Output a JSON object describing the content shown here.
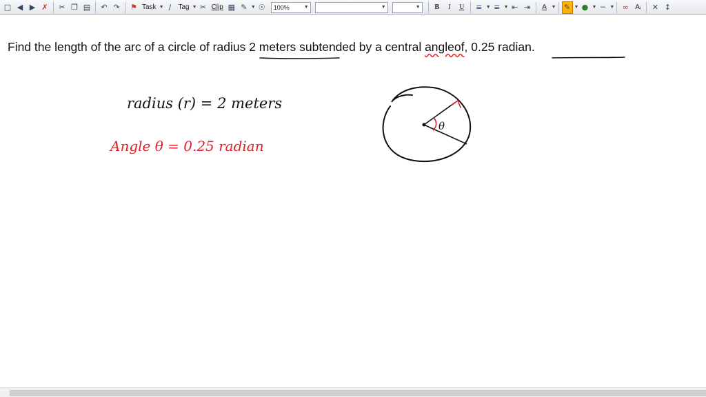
{
  "toolbar": {
    "task_label": "Task",
    "tag_label": "Tag",
    "clip_label": "Clip",
    "zoom_value": "100%",
    "font_name_value": "",
    "font_size_value": "",
    "bold_label": "B",
    "italic_label": "I",
    "underline_label": "U",
    "font_color_label": "A",
    "clear_format_label": "Aᵢ",
    "colors": {
      "highlight": "#ff9900",
      "font": "#c00000",
      "ink": "#2e7d32"
    },
    "icons": [
      "new-page-icon",
      "back-arrow-icon",
      "forward-arrow-icon",
      "delete-page-icon",
      "cut-icon",
      "copy-icon",
      "paste-icon",
      "undo-icon",
      "redo-icon",
      "flag-icon",
      "pen-icon",
      "clip-icon",
      "table-icon",
      "draw-icon",
      "link-icon",
      "bullets-icon",
      "numbering-icon",
      "outdent-icon",
      "indent-icon",
      "highlighter-icon",
      "ink-color-icon",
      "line-weight-icon",
      "lasso-icon",
      "close-icon",
      "expand-icon"
    ]
  },
  "question": {
    "part1": "Find the length of the arc of a circle of ",
    "radius_phrase": "radius  2 meters",
    "part2": " subtended by a central ",
    "angle_word": "angleof",
    "comma": ",",
    "value_phrase": " 0.25 radian",
    "period": "."
  },
  "handwriting": {
    "radius_note": "radius (r) = 2 meters",
    "angle_note": "Angle θ = 0.25 radian",
    "theta": "θ",
    "ink_black": "#111111",
    "ink_red": "#e0202a"
  }
}
